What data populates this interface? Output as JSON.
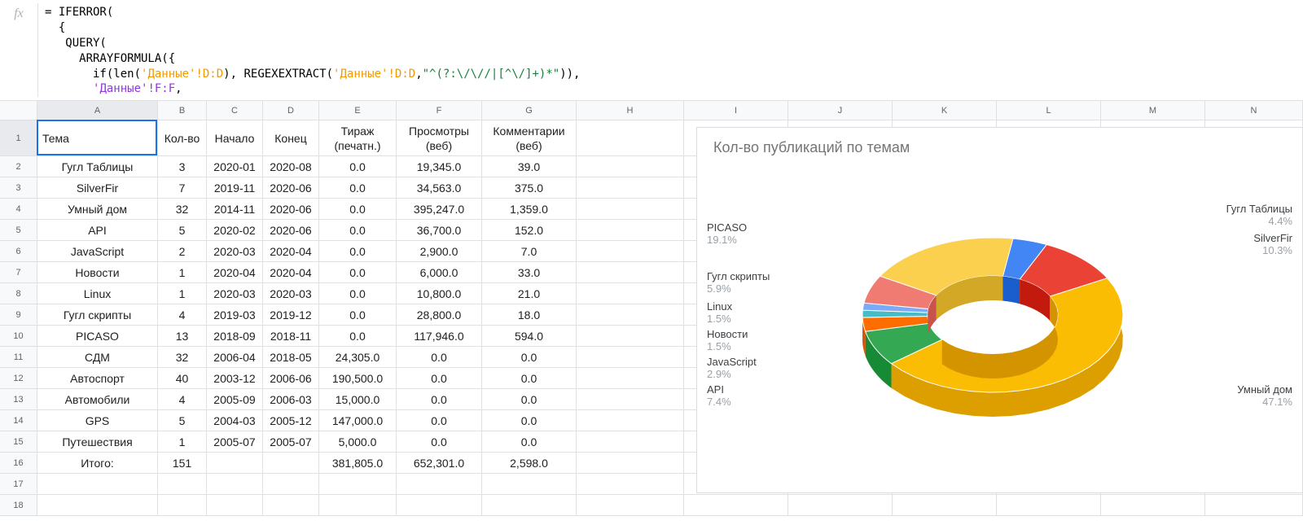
{
  "formula": {
    "line1": "= IFERROR(",
    "line2": "  {",
    "line3": "   QUERY(",
    "line4": "     ARRAYFORMULA({",
    "line5a": "       if(len(",
    "line5b": "'Данные'",
    "line5c": "!D:D",
    "line5d": "), REGEXEXTRACT(",
    "line5e": "'Данные'",
    "line5f": "!D:D",
    "line5g": ",",
    "line5h": "\"^(?:\\/\\//|[^\\/]+)*\"",
    "line5i": ")),",
    "line6a": "       ",
    "line6b": "'Данные'",
    "line6c": "!F:F",
    "line6d": ","
  },
  "columns": [
    "A",
    "B",
    "C",
    "D",
    "E",
    "F",
    "G",
    "H",
    "I",
    "J",
    "K",
    "L",
    "M",
    "N"
  ],
  "headers": [
    "Тема",
    "Кол-во",
    "Начало",
    "Конец",
    "Тираж\n(печатн.)",
    "Просмотры\n(веб)",
    "Комментарии\n(веб)"
  ],
  "rows": [
    [
      "Гугл Таблицы",
      "3",
      "2020-01",
      "2020-08",
      "0.0",
      "19,345.0",
      "39.0"
    ],
    [
      "SilverFir",
      "7",
      "2019-11",
      "2020-06",
      "0.0",
      "34,563.0",
      "375.0"
    ],
    [
      "Умный дом",
      "32",
      "2014-11",
      "2020-06",
      "0.0",
      "395,247.0",
      "1,359.0"
    ],
    [
      "API",
      "5",
      "2020-02",
      "2020-06",
      "0.0",
      "36,700.0",
      "152.0"
    ],
    [
      "JavaScript",
      "2",
      "2020-03",
      "2020-04",
      "0.0",
      "2,900.0",
      "7.0"
    ],
    [
      "Новости",
      "1",
      "2020-04",
      "2020-04",
      "0.0",
      "6,000.0",
      "33.0"
    ],
    [
      "Linux",
      "1",
      "2020-03",
      "2020-03",
      "0.0",
      "10,800.0",
      "21.0"
    ],
    [
      "Гугл скрипты",
      "4",
      "2019-03",
      "2019-12",
      "0.0",
      "28,800.0",
      "18.0"
    ],
    [
      "PICASO",
      "13",
      "2018-09",
      "2018-11",
      "0.0",
      "117,946.0",
      "594.0"
    ],
    [
      "СДМ",
      "32",
      "2006-04",
      "2018-05",
      "24,305.0",
      "0.0",
      "0.0"
    ],
    [
      "Автоспорт",
      "40",
      "2003-12",
      "2006-06",
      "190,500.0",
      "0.0",
      "0.0"
    ],
    [
      "Автомобили",
      "4",
      "2005-09",
      "2006-03",
      "15,000.0",
      "0.0",
      "0.0"
    ],
    [
      "GPS",
      "5",
      "2004-03",
      "2005-12",
      "147,000.0",
      "0.0",
      "0.0"
    ],
    [
      "Путешествия",
      "1",
      "2005-07",
      "2005-07",
      "5,000.0",
      "0.0",
      "0.0"
    ],
    [
      "Итого:",
      "151",
      "",
      "",
      "381,805.0",
      "652,301.0",
      "2,598.0"
    ]
  ],
  "chart": {
    "title": "Кол-во публикаций по темам"
  },
  "chart_data": {
    "type": "pie",
    "title": "Кол-во публикаций по темам",
    "series": [
      {
        "name": "Гугл Таблицы",
        "pct": 4.4,
        "color": "#4285f4"
      },
      {
        "name": "SilverFir",
        "pct": 10.3,
        "color": "#ea4335"
      },
      {
        "name": "Умный дом",
        "pct": 47.1,
        "color": "#fbbc04"
      },
      {
        "name": "API",
        "pct": 7.4,
        "color": "#34a853"
      },
      {
        "name": "JavaScript",
        "pct": 2.9,
        "color": "#ff6d01"
      },
      {
        "name": "Новости",
        "pct": 1.5,
        "color": "#46bdc6"
      },
      {
        "name": "Linux",
        "pct": 1.5,
        "color": "#7baaf7"
      },
      {
        "name": "Гугл скрипты",
        "pct": 5.9,
        "color": "#f07b72"
      },
      {
        "name": "PICASO",
        "pct": 19.1,
        "color": "#fcd04f"
      }
    ],
    "labels": {
      "picaso": {
        "name": "PICASO",
        "pct": "19.1%"
      },
      "scripts": {
        "name": "Гугл скрипты",
        "pct": "5.9%"
      },
      "linux": {
        "name": "Linux",
        "pct": "1.5%"
      },
      "news": {
        "name": "Новости",
        "pct": "1.5%"
      },
      "js": {
        "name": "JavaScript",
        "pct": "2.9%"
      },
      "api": {
        "name": "API",
        "pct": "7.4%"
      },
      "tables": {
        "name": "Гугл Таблицы",
        "pct": "4.4%"
      },
      "silverfir": {
        "name": "SilverFir",
        "pct": "10.3%"
      },
      "smarthome": {
        "name": "Умный дом",
        "pct": "47.1%"
      }
    }
  }
}
